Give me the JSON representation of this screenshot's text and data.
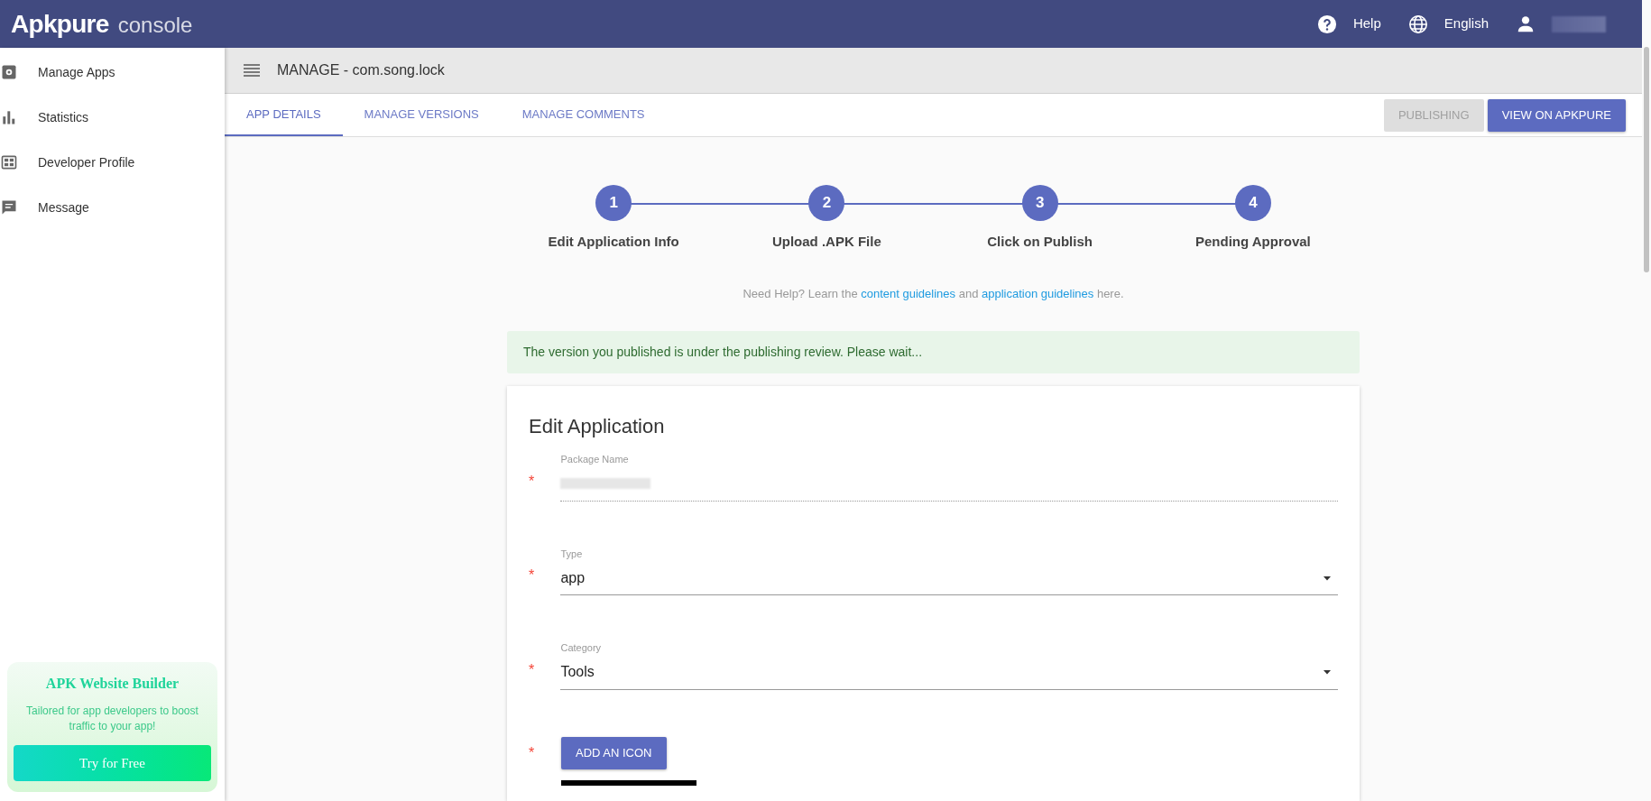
{
  "topbar": {
    "logo": "Apkpure",
    "logo_suffix": "console",
    "links": [
      {
        "kind": "help",
        "label": "Help"
      },
      {
        "kind": "language",
        "label": "English"
      },
      {
        "kind": "user",
        "redacted": true
      }
    ]
  },
  "sidebar": {
    "items": [
      {
        "label": "Manage Apps"
      },
      {
        "label": "Statistics"
      },
      {
        "label": "Developer Profile"
      },
      {
        "label": "Message"
      }
    ],
    "promo": {
      "title": "APK Website Builder",
      "text": "Tailored for app developers to boost traffic to your app!",
      "button": "Try for Free"
    }
  },
  "header": {
    "title": "MANAGE - com.song.lock"
  },
  "tabs": [
    {
      "label": "APP DETAILS",
      "selected": true
    },
    {
      "label": "MANAGE VERSIONS",
      "selected": false
    },
    {
      "label": "MANAGE COMMENTS",
      "selected": false
    }
  ],
  "actions": [
    {
      "label": "PUBLISHING",
      "disabled": true
    },
    {
      "label": "VIEW ON APKPURE",
      "disabled": false
    }
  ],
  "steps": [
    {
      "number": "1",
      "label": "Edit Application Info"
    },
    {
      "number": "2",
      "label": "Upload .APK File"
    },
    {
      "number": "3",
      "label": "Click on Publish"
    },
    {
      "number": "4",
      "label": "Pending Approval"
    }
  ],
  "help": [
    {
      "kind": "text",
      "text": "Need Help? Learn the "
    },
    {
      "kind": "link",
      "text": "content guidelines"
    },
    {
      "kind": "text",
      "text": " and "
    },
    {
      "kind": "link",
      "text": "application guidelines"
    },
    {
      "kind": "text",
      "text": " here."
    }
  ],
  "alert": "The version you published is under the publishing review. Please wait...",
  "form": {
    "title": "Edit Application",
    "fields": [
      {
        "kind": "text",
        "label": "Package Name",
        "mark": "*",
        "redacted": true
      },
      {
        "kind": "select",
        "label": "Type",
        "mark": "*",
        "value": "app"
      },
      {
        "kind": "select",
        "label": "Category",
        "mark": "*",
        "value": "Tools"
      },
      {
        "kind": "button",
        "mark": "*",
        "value": "ADD AN ICON"
      }
    ]
  }
}
